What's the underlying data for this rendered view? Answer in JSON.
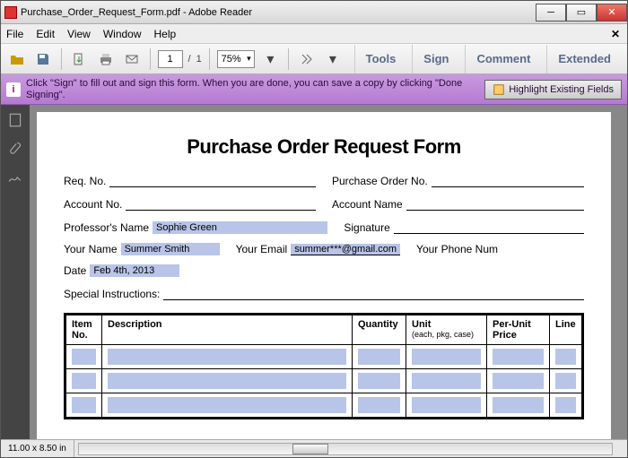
{
  "window": {
    "title": "Purchase_Order_Request_Form.pdf - Adobe Reader"
  },
  "menu": {
    "file": "File",
    "edit": "Edit",
    "view": "View",
    "window": "Window",
    "help": "Help"
  },
  "toolbar": {
    "page_current": "1",
    "page_sep": "/",
    "page_total": "1",
    "zoom": "75%",
    "panels": {
      "tools": "Tools",
      "sign": "Sign",
      "comment": "Comment",
      "extended": "Extended"
    }
  },
  "signbar": {
    "message": "Click \"Sign\" to fill out and sign this form. When you are done, you can save a copy by clicking \"Done Signing\".",
    "highlight_btn": "Highlight Existing Fields"
  },
  "form": {
    "title": "Purchase Order Request Form",
    "labels": {
      "req_no": "Req. No.",
      "po_no": "Purchase Order No.",
      "acct_no": "Account No.",
      "acct_name": "Account Name",
      "prof": "Professor's Name",
      "signature": "Signature",
      "your_name": "Your Name",
      "your_email": "Your Email",
      "your_phone": "Your Phone Num",
      "date": "Date",
      "special": "Special Instructions:"
    },
    "values": {
      "prof": "Sophie Green",
      "your_name": "Summer Smith",
      "your_email": "summer***@gmail.com",
      "date": "Feb 4th, 2013"
    },
    "table": {
      "headers": {
        "item_no": "Item No.",
        "desc": "Description",
        "qty": "Quantity",
        "unit": "Unit",
        "unit_sub": "(each, pkg, case)",
        "price": "Per-Unit Price",
        "line": "Line"
      }
    }
  },
  "status": {
    "dimensions": "11.00 x 8.50 in"
  }
}
